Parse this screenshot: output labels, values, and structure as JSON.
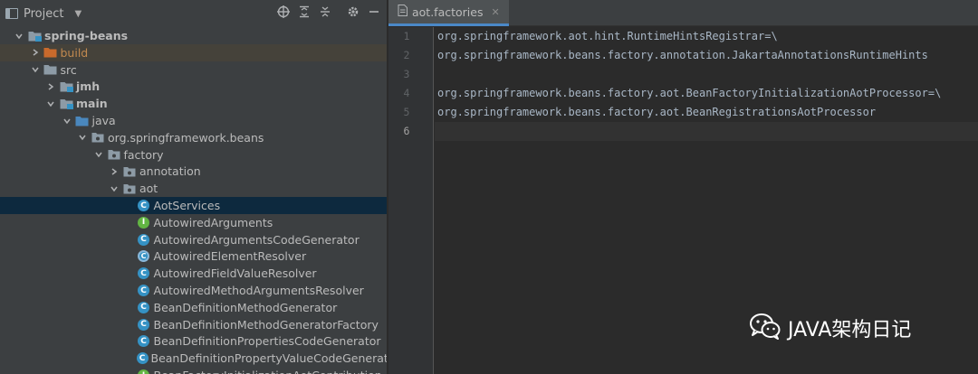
{
  "project_panel": {
    "title": "Project",
    "toolbar_icons": [
      "crosshair-icon",
      "expand-all-icon",
      "collapse-all-icon",
      "gear-icon",
      "minimize-icon"
    ]
  },
  "tree": [
    {
      "label": "spring-beans",
      "indent": 1,
      "expanded": true,
      "icon": "module-folder-icon",
      "bold": true
    },
    {
      "label": "build",
      "indent": 2,
      "expanded": false,
      "icon": "excluded-folder-icon",
      "orange": true
    },
    {
      "label": "src",
      "indent": 2,
      "expanded": true,
      "icon": "folder-icon"
    },
    {
      "label": "jmh",
      "indent": 3,
      "expanded": false,
      "icon": "module-folder-icon",
      "bold": true
    },
    {
      "label": "main",
      "indent": 3,
      "expanded": true,
      "icon": "module-folder-icon",
      "bold": true
    },
    {
      "label": "java",
      "indent": 4,
      "expanded": true,
      "icon": "source-folder-icon"
    },
    {
      "label": "org.springframework.beans",
      "indent": 5,
      "expanded": true,
      "icon": "package-icon"
    },
    {
      "label": "factory",
      "indent": 6,
      "expanded": true,
      "icon": "package-icon"
    },
    {
      "label": "annotation",
      "indent": 7,
      "expanded": false,
      "icon": "package-icon"
    },
    {
      "label": "aot",
      "indent": 7,
      "expanded": true,
      "icon": "package-icon"
    },
    {
      "label": "AotServices",
      "indent": 8,
      "icon": "class-icon",
      "selected": true
    },
    {
      "label": "AutowiredArguments",
      "indent": 8,
      "icon": "interface-icon"
    },
    {
      "label": "AutowiredArgumentsCodeGenerator",
      "indent": 8,
      "icon": "class-icon"
    },
    {
      "label": "AutowiredElementResolver",
      "indent": 8,
      "icon": "abstract-class-icon"
    },
    {
      "label": "AutowiredFieldValueResolver",
      "indent": 8,
      "icon": "class-icon"
    },
    {
      "label": "AutowiredMethodArgumentsResolver",
      "indent": 8,
      "icon": "class-icon"
    },
    {
      "label": "BeanDefinitionMethodGenerator",
      "indent": 8,
      "icon": "class-icon"
    },
    {
      "label": "BeanDefinitionMethodGeneratorFactory",
      "indent": 8,
      "icon": "class-icon"
    },
    {
      "label": "BeanDefinitionPropertiesCodeGenerator",
      "indent": 8,
      "icon": "class-icon"
    },
    {
      "label": "BeanDefinitionPropertyValueCodeGenerator",
      "indent": 8,
      "icon": "class-icon"
    },
    {
      "label": "BeanFactoryInitializationAotContribution",
      "indent": 8,
      "icon": "interface-icon"
    }
  ],
  "editor": {
    "tab_label": "aot.factories",
    "tab_icon": "file-icon",
    "line_numbers": [
      "1",
      "2",
      "3",
      "4",
      "5",
      "6"
    ],
    "current_line": 6,
    "lines": [
      "org.springframework.aot.hint.RuntimeHintsRegistrar=\\",
      "org.springframework.beans.factory.annotation.JakartaAnnotationsRuntimeHints",
      "",
      "org.springframework.beans.factory.aot.BeanFactoryInitializationAotProcessor=\\",
      "org.springframework.beans.factory.aot.BeanRegistrationsAotProcessor",
      ""
    ]
  },
  "watermark": {
    "text": "JAVA架构日记",
    "icon": "wechat-icon"
  },
  "colors": {
    "panel_bg": "#3c3f41",
    "editor_bg": "#2b2b2b",
    "selection": "#0d293e",
    "tab_underline": "#4a88c7",
    "code_text": "#a9b7c6"
  }
}
